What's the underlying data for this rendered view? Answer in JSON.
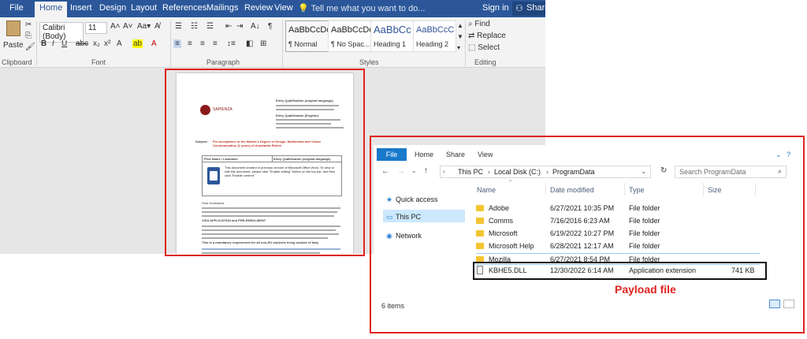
{
  "word": {
    "tabs": [
      "File",
      "Home",
      "Insert",
      "Design",
      "Layout",
      "References",
      "Mailings",
      "Review",
      "View"
    ],
    "active_tab": "Home",
    "tell_me": "Tell me what you want to do...",
    "sign_in": "Sign in",
    "share": "Share",
    "font_name": "Calibri (Body)",
    "font_size": "11",
    "paste_label": "Paste",
    "groups": {
      "clipboard": "Clipboard",
      "font": "Font",
      "paragraph": "Paragraph",
      "styles": "Styles",
      "editing": "Editing"
    },
    "styles": [
      {
        "preview": "AaBbCcDc",
        "name": "¶ Normal"
      },
      {
        "preview": "AaBbCcDc",
        "name": "¶ No Spac..."
      },
      {
        "preview": "AaBbCc",
        "name": "Heading 1"
      },
      {
        "preview": "AaBbCcC",
        "name": "Heading 2"
      }
    ],
    "editing": {
      "find": "Find",
      "replace": "Replace",
      "select": "Select"
    },
    "document": {
      "subject_label": "Subject:",
      "subject_text": "Pre-acceptance to the Master's Degree in Design, Multimedia and Visual Communication (2 years) of Anastasiia Rolich",
      "logo": "SAPIENZA",
      "entry_qual": "Entry Qualification (original language):",
      "entry_qual_en": "Entry Qualification (English):",
      "table_h1": "First Name / Lastname",
      "table_h2": "Entry Qualification (original language)",
      "enable_msg": "This document created in previous version of Microsoft Office Word. To view or edit this document, please click \"Enable editing\" button on the top bar, and then click \"Enable content\"",
      "dear": "Dear Anastasiia,",
      "app_pre": "VISA APPLICATION and PRE-ENROLMENT",
      "mandatory": "This is a mandatory requirement for all non-EU students living outside of Italy."
    }
  },
  "explorer": {
    "tabs": [
      "File",
      "Home",
      "Share",
      "View"
    ],
    "breadcrumb": [
      "This PC",
      "Local Disk (C:)",
      "ProgramData"
    ],
    "search_placeholder": "Search ProgramData",
    "nav": [
      "Quick access",
      "This PC",
      "Network"
    ],
    "columns": [
      "Name",
      "Date modified",
      "Type",
      "Size"
    ],
    "rows": [
      {
        "name": "Adobe",
        "date": "6/27/2021 10:35 PM",
        "type": "File folder",
        "size": ""
      },
      {
        "name": "Comms",
        "date": "7/16/2016 6:23 AM",
        "type": "File folder",
        "size": ""
      },
      {
        "name": "Microsoft",
        "date": "6/19/2022 10:27 PM",
        "type": "File folder",
        "size": ""
      },
      {
        "name": "Microsoft Help",
        "date": "6/28/2021 12:17 AM",
        "type": "File folder",
        "size": ""
      },
      {
        "name": "Mozilla",
        "date": "6/27/2021 8:54 PM",
        "type": "File folder",
        "size": ""
      },
      {
        "name": "KBHE5.DLL",
        "date": "12/30/2022 6:14 AM",
        "type": "Application extension",
        "size": "741 KB"
      }
    ],
    "items_count": "6 items",
    "payload_label": "Payload file"
  },
  "colors": {
    "word_blue": "#2b579a",
    "highlight_red": "#e0231f",
    "explorer_blue": "#1979ca",
    "folder_yellow": "#f4c431"
  }
}
